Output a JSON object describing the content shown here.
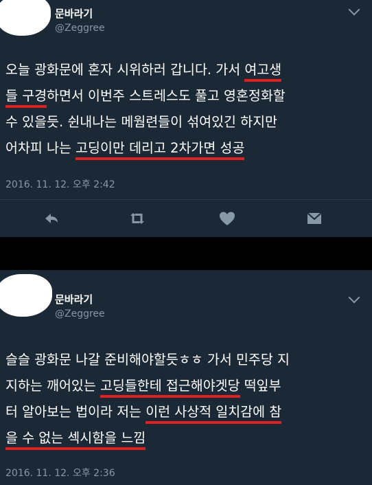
{
  "colors": {
    "card_bg": "#1b2836",
    "page_bg": "#000000",
    "text": "#ffffff",
    "muted": "#8899a6",
    "underline": "#e02020"
  },
  "tweets": [
    {
      "display_name": "문바라기",
      "handle": "@Zeggree",
      "lines": [
        [
          {
            "t": "오늘 광화문에 혼자 시위하러 갑니다. 가서 "
          },
          {
            "t": "여고생",
            "u": true
          }
        ],
        [
          {
            "t": "들 구경",
            "u": true
          },
          {
            "t": "하면서 이번주 스트레스도 풀고 영혼정화할"
          }
        ],
        [
          {
            "t": "수 있을듯. 쉰내나는 메웜련들이 섞여있긴 하지만"
          }
        ],
        [
          {
            "t": "어차피 나는 "
          },
          {
            "t": "고딩이만 데리고 2차가면 성공",
            "u": true
          }
        ]
      ],
      "timestamp": "2016. 11. 12. 오후 2:42",
      "actions": [
        "reply-icon",
        "retweet-icon",
        "like-heart-icon",
        "direct-message-icon"
      ]
    },
    {
      "display_name": "문바라기",
      "handle": "@Zeggree",
      "lines": [
        [
          {
            "t": "슬슬 광화문 나갈 준비해야할듯ㅎㅎ 가서 민주당 지"
          }
        ],
        [
          {
            "t": "지하는 깨어있는 "
          },
          {
            "t": "고딩들한테 접근해야겟당",
            "u": true
          },
          {
            "t": " 떡잎부"
          }
        ],
        [
          {
            "t": "터 알아보는 법이라 저는 "
          },
          {
            "t": "이런 사상적 일치감에 참",
            "u": true
          }
        ],
        [
          {
            "t": "을 수 없는 섹시함을 느낌",
            "u": true
          }
        ]
      ],
      "timestamp": "2016. 11. 12. 오후 2:36"
    }
  ]
}
